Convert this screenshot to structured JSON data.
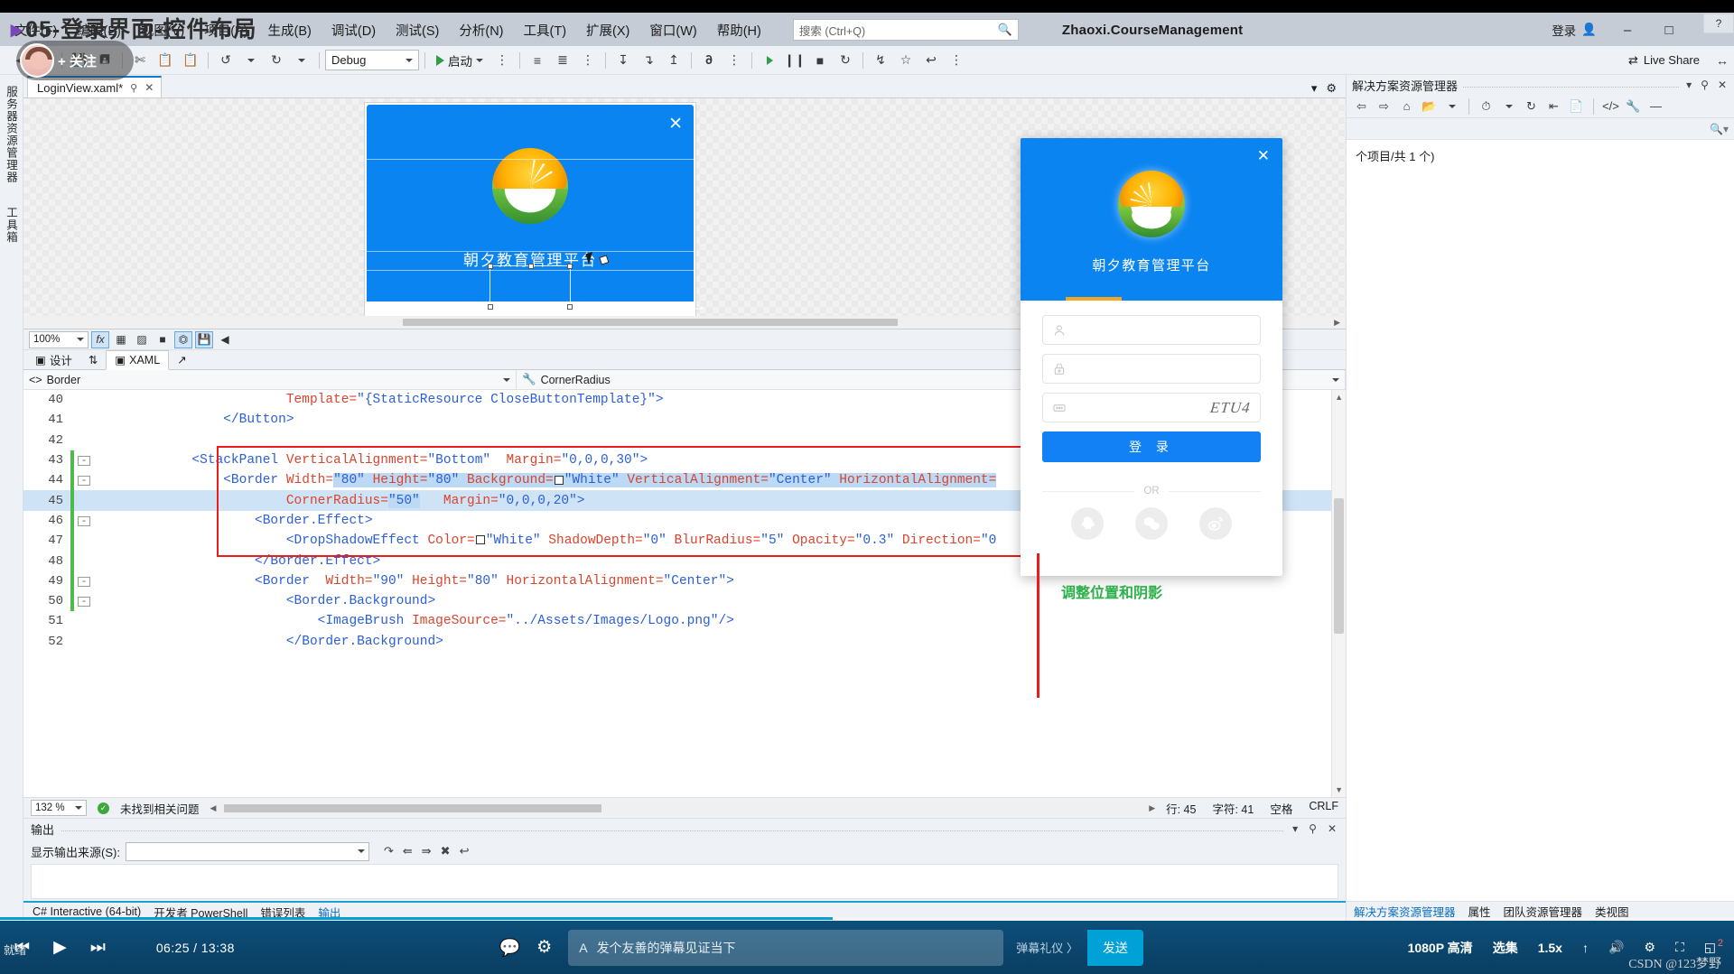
{
  "overlay": {
    "headline": "05-登录界面-控件布局",
    "follow_label": "+ 关注",
    "watermark": "CSDN @123梦野"
  },
  "titlebar": {
    "menus": [
      "文件(F)",
      "编辑(E)",
      "视图(V)",
      "项目(P)",
      "生成(B)",
      "调试(D)",
      "测试(S)",
      "分析(N)",
      "工具(T)",
      "扩展(X)",
      "窗口(W)",
      "帮助(H)"
    ],
    "search_placeholder": "搜索 (Ctrl+Q)",
    "project_title": "Zhaoxi.CourseManagement",
    "signin_label": "登录",
    "minimize": "–",
    "maximize": "□",
    "close": "✕",
    "help_badge": "?"
  },
  "toolbar": {
    "config": "Debug",
    "start_label": "启动",
    "liveshare_label": "Live Share"
  },
  "left_rail": {
    "items": [
      "服务器资源管理器",
      "工具箱"
    ]
  },
  "doc_tab": {
    "title": "LoginView.xaml*",
    "pin": "⚲",
    "close": "✕"
  },
  "designer": {
    "preview_title": "朝夕教育管理平台",
    "close_glyph": "✕",
    "zoom": "100%",
    "view_tabs": [
      {
        "label": "设计",
        "active": false
      },
      {
        "label": "XAML",
        "active": true
      }
    ],
    "swap_icon": "⇅"
  },
  "navbar": {
    "left": "Border",
    "right": "CornerRadius"
  },
  "code": {
    "lines": [
      {
        "num": "40",
        "indent": 0,
        "fold": "",
        "change": "none",
        "highlight": false,
        "tokens": [
          {
            "t": "attr",
            "v": "                        Template="
          },
          {
            "t": "val",
            "v": "\"{StaticResource CloseButtonTemplate}\""
          },
          {
            "t": "tag",
            "v": "&gt;"
          }
        ]
      },
      {
        "num": "41",
        "indent": 0,
        "fold": "",
        "change": "none",
        "highlight": false,
        "tokens": [
          {
            "t": "tag",
            "v": "                &lt;/Button&gt;"
          }
        ]
      },
      {
        "num": "42",
        "indent": 0,
        "fold": "",
        "change": "none",
        "highlight": false,
        "tokens": []
      },
      {
        "num": "43",
        "indent": 0,
        "fold": "-",
        "change": "green",
        "highlight": false,
        "tokens": [
          {
            "t": "tag",
            "v": "            &lt;StackPanel "
          },
          {
            "t": "attr",
            "v": "VerticalAlignment="
          },
          {
            "t": "val",
            "v": "\"Bottom\""
          },
          {
            "t": "attr",
            "v": "  Margin="
          },
          {
            "t": "val",
            "v": "\"0,0,0,30\""
          },
          {
            "t": "tag",
            "v": "&gt;"
          }
        ]
      },
      {
        "num": "44",
        "indent": 1,
        "fold": "-",
        "change": "green",
        "highlight": false,
        "tokens": [
          {
            "t": "tag",
            "v": "                &lt;Border "
          },
          {
            "t": "attr",
            "v": "Width="
          },
          {
            "t": "sel-val",
            "v": "\"80\""
          },
          {
            "t": "sel-attr",
            "v": " Height="
          },
          {
            "t": "sel-val",
            "v": "\"80\""
          },
          {
            "t": "sel-attr",
            "v": " Background="
          },
          {
            "t": "sel-chip",
            "v": ""
          },
          {
            "t": "sel-val",
            "v": "\"White\""
          },
          {
            "t": "sel-attr",
            "v": " VerticalAlignment="
          },
          {
            "t": "sel-val",
            "v": "\"Center\""
          },
          {
            "t": "sel-attr",
            "v": " HorizontalAlignment="
          }
        ]
      },
      {
        "num": "45",
        "indent": 2,
        "fold": "",
        "change": "green",
        "highlight": true,
        "tokens": [
          {
            "t": "attr",
            "v": "                        CornerRadius="
          },
          {
            "t": "sel-val",
            "v": "\"50\""
          },
          {
            "t": "attr",
            "v": "   Margin="
          },
          {
            "t": "val",
            "v": "\"0,0,0,20\""
          },
          {
            "t": "tag",
            "v": "&gt;"
          }
        ]
      },
      {
        "num": "46",
        "indent": 2,
        "fold": "-",
        "change": "green",
        "highlight": false,
        "tokens": [
          {
            "t": "tag",
            "v": "                    &lt;Border.Effect&gt;"
          }
        ]
      },
      {
        "num": "47",
        "indent": 3,
        "fold": "",
        "change": "green",
        "highlight": false,
        "tokens": [
          {
            "t": "tag",
            "v": "                        &lt;DropShadowEffect "
          },
          {
            "t": "attr",
            "v": "Color="
          },
          {
            "t": "chip",
            "v": ""
          },
          {
            "t": "val",
            "v": "\"White\""
          },
          {
            "t": "attr",
            "v": " ShadowDepth="
          },
          {
            "t": "val",
            "v": "\"0\""
          },
          {
            "t": "attr",
            "v": " BlurRadius="
          },
          {
            "t": "val",
            "v": "\"5\""
          },
          {
            "t": "attr",
            "v": " Opacity="
          },
          {
            "t": "val",
            "v": "\"0.3\""
          },
          {
            "t": "attr",
            "v": " Direction="
          },
          {
            "t": "val",
            "v": "\"0"
          }
        ]
      },
      {
        "num": "48",
        "indent": 2,
        "fold": "",
        "change": "green",
        "highlight": false,
        "tokens": [
          {
            "t": "tag",
            "v": "                    &lt;/Border.Effect&gt;"
          }
        ]
      },
      {
        "num": "49",
        "indent": 2,
        "fold": "-",
        "change": "green",
        "highlight": false,
        "tokens": [
          {
            "t": "tag",
            "v": "                    &lt;Border  "
          },
          {
            "t": "attr",
            "v": "Width="
          },
          {
            "t": "val",
            "v": "\"90\""
          },
          {
            "t": "attr",
            "v": " Height="
          },
          {
            "t": "val",
            "v": "\"80\""
          },
          {
            "t": "attr",
            "v": " HorizontalAlignment="
          },
          {
            "t": "val",
            "v": "\"Center\""
          },
          {
            "t": "tag",
            "v": "&gt;"
          }
        ]
      },
      {
        "num": "50",
        "indent": 3,
        "fold": "-",
        "change": "green",
        "highlight": false,
        "tokens": [
          {
            "t": "tag",
            "v": "                        &lt;Border.Background&gt;"
          }
        ]
      },
      {
        "num": "51",
        "indent": 4,
        "fold": "",
        "change": "none",
        "highlight": false,
        "tokens": [
          {
            "t": "tag",
            "v": "                            &lt;ImageBrush "
          },
          {
            "t": "attr",
            "v": "ImageSource="
          },
          {
            "t": "val",
            "v": "\"../Assets/Images/Logo.png\""
          },
          {
            "t": "tag",
            "v": "/&gt;"
          }
        ]
      },
      {
        "num": "52",
        "indent": 3,
        "fold": "",
        "change": "none",
        "highlight": false,
        "tokens": [
          {
            "t": "tag",
            "v": "                        &lt;/Border.Background&gt;"
          }
        ]
      }
    ]
  },
  "editor_status": {
    "zoom": "132 %",
    "issues": "未找到相关问题",
    "line": "行: 45",
    "char": "字符: 41",
    "spaces": "空格",
    "eol": "CRLF",
    "ok_glyph": "✓"
  },
  "output": {
    "title": "输出",
    "source_label": "显示输出来源(S):",
    "source_value": "",
    "dropdown_caret": "▾",
    "pin": "⚲",
    "close": "✕",
    "tabs": [
      {
        "label": "C# Interactive (64-bit)",
        "active": false
      },
      {
        "label": "开发者 PowerShell",
        "active": false
      },
      {
        "label": "错误列表",
        "active": false
      },
      {
        "label": "输出",
        "active": true
      }
    ]
  },
  "solution_explorer": {
    "title": "解决方案资源管理器",
    "search_placeholder": "",
    "item_count": "个项目/共 1 个)",
    "pin": "⚲",
    "close": "✕",
    "dropdown": "▾",
    "bottom_tabs": [
      {
        "label": "解决方案资源管理器",
        "active": true
      },
      {
        "label": "属性",
        "active": false
      },
      {
        "label": "团队资源管理器",
        "active": false
      },
      {
        "label": "类视图",
        "active": false
      }
    ]
  },
  "login_window": {
    "title": "朝夕教育管理平台",
    "close": "✕",
    "username_placeholder": "",
    "password_placeholder": "",
    "captcha_text": "ETU4",
    "login_button": "登    录",
    "or_label": "OR",
    "social": [
      "qq-icon",
      "wechat-icon",
      "weibo-icon"
    ],
    "annotation": "调整位置和阴影"
  },
  "player": {
    "prev_glyph": "⏮",
    "play_glyph": "▶",
    "next_glyph": "⏭",
    "time": "06:25 / 13:38",
    "danmu_placeholder": "发个友善的弹幕见证当下",
    "danmu_etiquette": "弹幕礼仪 〉",
    "send_label": "发送",
    "quality": "1080P 高清",
    "episodes": "选集",
    "speed": "1.5x",
    "status_ready": "就绪",
    "right_icons": [
      "volume-icon",
      "settings-icon",
      "pip-icon",
      "fullscreen-icon"
    ],
    "badge": "2"
  },
  "colors": {
    "accent_blue": "#0a84f0",
    "vs_chrome": "#eef1f6",
    "annotation_red": "#ec1c1c",
    "annotation_green": "#2bb34a",
    "player_blue": "#0d4f7a",
    "send_blue": "#00a1d6"
  }
}
